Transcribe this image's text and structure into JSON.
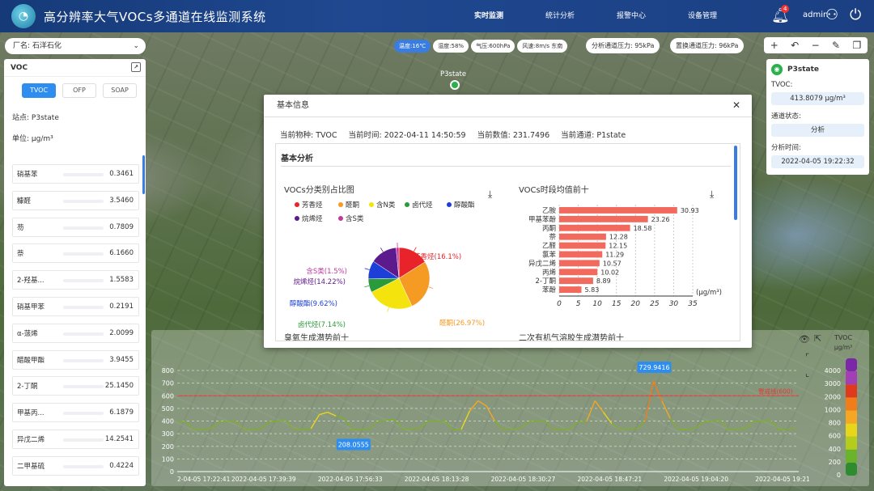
{
  "header": {
    "title": "高分辨率大气VOCs多通道在线监测系统",
    "nav": [
      "实时监测",
      "统计分析",
      "报警中心",
      "设备管理"
    ],
    "badge": "4",
    "user": "admin"
  },
  "plant": {
    "label": "厂名:",
    "value": "石洋石化"
  },
  "weather": [
    "温度:16℃",
    "湿度:58%",
    "气压:600hPa",
    "风速:8m/s 东南"
  ],
  "pressure": [
    "分析通道压力: 95kPa",
    "置换通道压力: 96kPa"
  ],
  "left": {
    "title": "VOC",
    "tabs": [
      "TVOC",
      "OFP",
      "SOAP"
    ],
    "station_label": "站点:",
    "station": "P3state",
    "unit_label": "单位:",
    "unit": "μg/m³",
    "items": [
      {
        "name": "硝基苯",
        "value": "0.3461"
      },
      {
        "name": "糠醛",
        "value": "3.5460"
      },
      {
        "name": "芴",
        "value": "0.7809"
      },
      {
        "name": "萘",
        "value": "6.1660"
      },
      {
        "name": "2-羟基...",
        "value": "1.5583"
      },
      {
        "name": "硝基甲苯",
        "value": "0.2191"
      },
      {
        "name": "α-蒎烯",
        "value": "2.0099"
      },
      {
        "name": "醋酸甲酯",
        "value": "3.9455"
      },
      {
        "name": "2-丁酮",
        "value": "25.1450"
      },
      {
        "name": "甲基丙...",
        "value": "6.1879"
      },
      {
        "name": "异戊二烯",
        "value": "14.2541"
      },
      {
        "name": "二甲基硫",
        "value": "0.4224"
      }
    ]
  },
  "right": {
    "title": "P3state",
    "tvoc_label": "TVOC:",
    "tvoc": "413.8079  μg/m³",
    "status_label": "通道状态:",
    "status": "分析",
    "time_label": "分析时间:",
    "time": "2022-04-05 19:22:32"
  },
  "map": {
    "station": "P3state"
  },
  "modal": {
    "title": "基本信息",
    "info": [
      "当前物种: TVOC",
      "当前时间: 2022-04-11 14:50:59",
      "当前数值: 231.7496",
      "当前通道: P1state"
    ],
    "section": "基本分析",
    "pie_title": "VOCs分类别占比图",
    "bar_title": "VOCs时段均值前十",
    "ozone_title": "臭氧生成潜势前十",
    "soa_title": "二次有机气溶胶生成潜势前十"
  },
  "chart_data": [
    {
      "type": "pie",
      "title": "VOCs分类别占比图",
      "legend": [
        "芳香烃",
        "醛酮",
        "含N类",
        "卤代烃",
        "醇酸酯",
        "烷烯烃",
        "含S类"
      ],
      "colors": [
        "#e8242a",
        "#f59a23",
        "#f4e30c",
        "#2a9b3a",
        "#1d3fd8",
        "#5c1a8c",
        "#c2389f"
      ],
      "values": [
        16.1,
        26.97,
        24.45,
        7.14,
        9.62,
        14.22,
        1.5
      ],
      "labels": [
        "芳香烃(16.1%)",
        "醛酮(26.97%)",
        "含N类(24.45%)",
        "卤代烃(7.14%)",
        "醇酸酯(9.62%)",
        "烷烯烃(14.22%)",
        "含S类(1.5%)"
      ]
    },
    {
      "type": "bar",
      "title": "VOCs时段均值前十",
      "categories": [
        "乙胺",
        "甲基苯酚",
        "丙酮",
        "萘",
        "乙醛",
        "氯苯",
        "异戊二烯",
        "丙烯",
        "2-丁酮",
        "苯酚"
      ],
      "values": [
        30.93,
        23.26,
        18.58,
        12.28,
        12.15,
        11.29,
        10.57,
        10.02,
        8.89,
        5.83
      ],
      "xlim": [
        0,
        35
      ],
      "xticks": [
        0,
        5,
        10,
        15,
        20,
        25,
        30,
        35
      ],
      "xlabel": "(μg/m³)",
      "color": "#f26a5e"
    },
    {
      "type": "line",
      "series_note": "TVOC",
      "yticks": [
        0,
        100,
        200,
        300,
        400,
        500,
        600,
        700,
        800
      ],
      "ylim": [
        0,
        800
      ],
      "xticks": [
        "2-04-05 17:22:41",
        "2022-04-05 17:39:39",
        "2022-04-05 17:56:33",
        "2022-04-05 18:13:28",
        "2022-04-05 18:30:27",
        "2022-04-05 18:47:21",
        "2022-04-05 19:04:20",
        "2022-04-05 19:21"
      ],
      "warn": 600,
      "warn_label": "警戒线(600)",
      "max_label": "729.9416",
      "min_label": "208.0555",
      "max_value": 729.9416,
      "min_value": 208.0555,
      "y": [
        400,
        395,
        330,
        335,
        338,
        392,
        398,
        402,
        330,
        335,
        340,
        395,
        400,
        405,
        332,
        336,
        340,
        450,
        470,
        440,
        420,
        330,
        335,
        338,
        395,
        405,
        410,
        335,
        338,
        340,
        398,
        400,
        402,
        332,
        335,
        480,
        560,
        520,
        400,
        332,
        338,
        340,
        392,
        400,
        402,
        330,
        336,
        338,
        395,
        398,
        560,
        470,
        380,
        335,
        338,
        340,
        395,
        720,
        560,
        420,
        332,
        335,
        340,
        395,
        400,
        405,
        330,
        336,
        338,
        398,
        400,
        402,
        332,
        334,
        340
      ]
    },
    {
      "type": "legend-scale",
      "title": "TVOC",
      "unit": "μg/m³",
      "ticks": [
        0,
        200,
        400,
        600,
        800,
        1000,
        2000,
        3000,
        4000
      ],
      "colors": [
        "#2e8b2e",
        "#6bb32a",
        "#b4cc1c",
        "#e8d61a",
        "#f5a623",
        "#f07c1a",
        "#e03a1e",
        "#a23fb5",
        "#7a28a8"
      ]
    }
  ]
}
